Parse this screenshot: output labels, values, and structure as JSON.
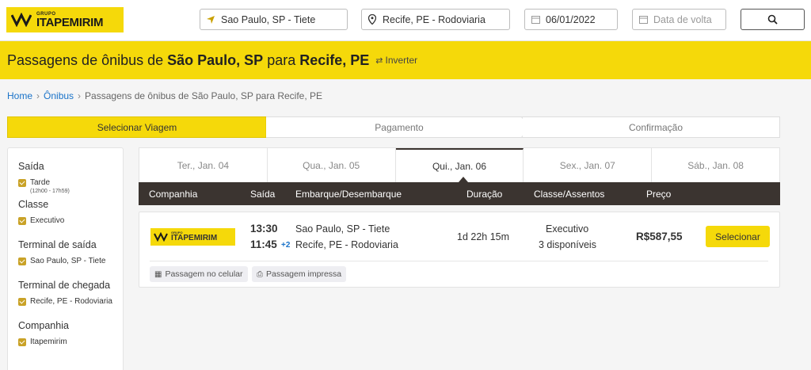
{
  "header": {
    "logo_small": "GRUPO",
    "logo_big": "ITAPEMIRIM",
    "origin": "Sao Paulo, SP - Tiete",
    "destination": "Recife, PE - Rodoviaria",
    "departure_date": "06/01/2022",
    "return_placeholder": "Data de volta"
  },
  "band": {
    "prefix": "Passagens de ônibus de ",
    "origin": "São Paulo, SP",
    "mid": " para ",
    "destination": "Recife, PE",
    "invert_label": "Inverter"
  },
  "breadcrumb": {
    "home": "Home",
    "onibus": "Ônibus",
    "current": "Passagens de ônibus de São Paulo, SP para Recife, PE"
  },
  "steps": [
    "Selecionar Viagem",
    "Pagamento",
    "Confirmação"
  ],
  "sidebar": {
    "saida_title": "Saída",
    "saida_option": "Tarde",
    "saida_sub": "(12h00 - 17h59)",
    "classe_title": "Classe",
    "classe_option": "Executivo",
    "terminal_saida_title": "Terminal de saída",
    "terminal_saida_option": "Sao Paulo, SP - Tiete",
    "terminal_chegada_title": "Terminal de chegada",
    "terminal_chegada_option": "Recife, PE - Rodoviaria",
    "companhia_title": "Companhia",
    "companhia_option": "Itapemirim"
  },
  "days": [
    "Ter., Jan. 04",
    "Qua., Jan. 05",
    "Qui., Jan. 06",
    "Sex., Jan. 07",
    "Sáb., Jan. 08"
  ],
  "columns": {
    "companhia": "Companhia",
    "saida": "Saída",
    "embarque": "Embarque/Desembarque",
    "duracao": "Duração",
    "classe": "Classe/Assentos",
    "preco": "Preço"
  },
  "trip": {
    "logo_small": "GRUPO",
    "logo_big": "ITAPEMIRIM",
    "depart_time": "13:30",
    "arrive_time": "11:45",
    "plus_days": "+2",
    "origin": "Sao Paulo, SP - Tiete",
    "destination": "Recife, PE - Rodoviaria",
    "duration": "1d 22h 15m",
    "class": "Executivo",
    "seats": "3 disponíveis",
    "price": "R$587,55",
    "select_label": "Selecionar",
    "tag_mobile": "Passagem no celular",
    "tag_print": "Passagem impressa"
  },
  "colors": {
    "brand_yellow": "#f5d90a",
    "header_dark": "#3b3430",
    "link_blue": "#1a73c9"
  }
}
